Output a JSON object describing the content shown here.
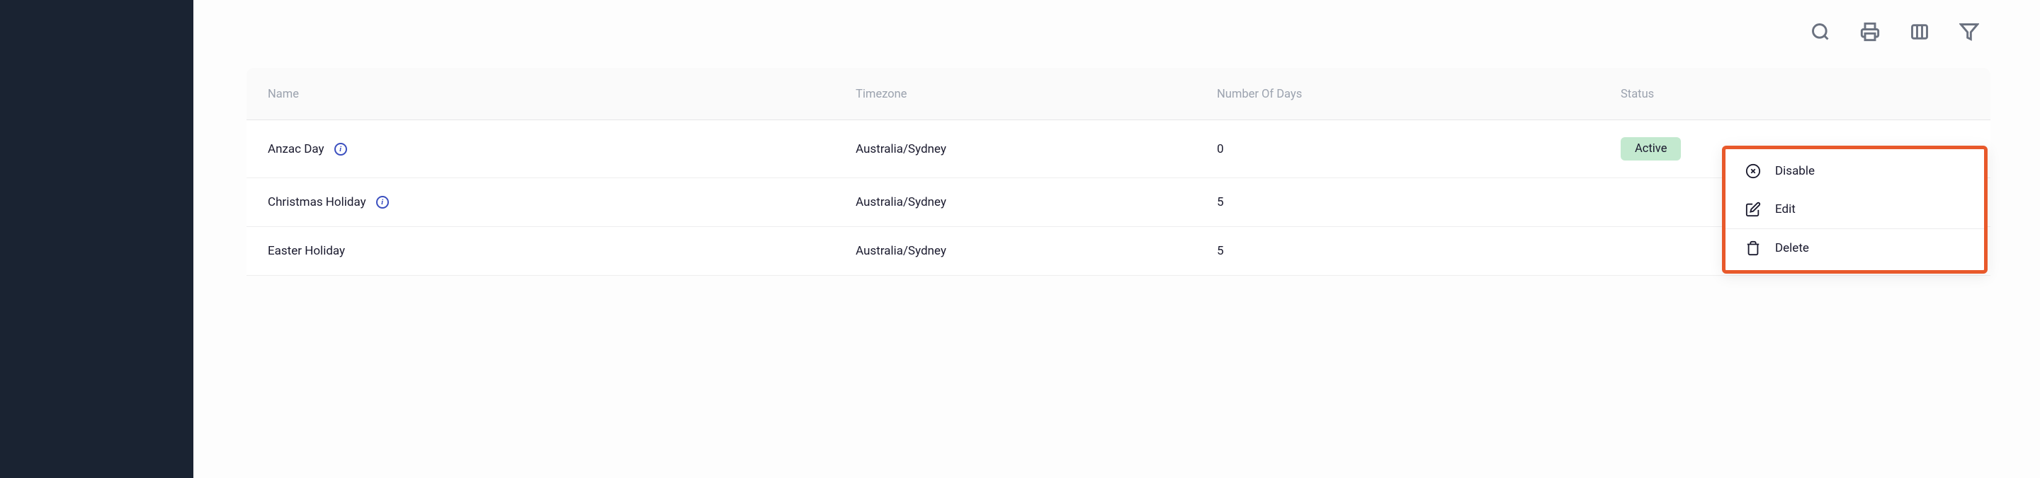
{
  "table": {
    "headers": {
      "name": "Name",
      "timezone": "Timezone",
      "days": "Number Of Days",
      "status": "Status"
    },
    "rows": [
      {
        "name": "Anzac Day",
        "timezone": "Australia/Sydney",
        "days": "0",
        "status": "Active",
        "show_status": true
      },
      {
        "name": "Christmas Holiday",
        "timezone": "Australia/Sydney",
        "days": "5",
        "status": "",
        "show_status": false
      },
      {
        "name": "Easter Holiday",
        "timezone": "Australia/Sydney",
        "days": "5",
        "status": "",
        "show_status": false
      }
    ]
  },
  "menu": {
    "disable": "Disable",
    "edit": "Edit",
    "delete": "Delete"
  }
}
